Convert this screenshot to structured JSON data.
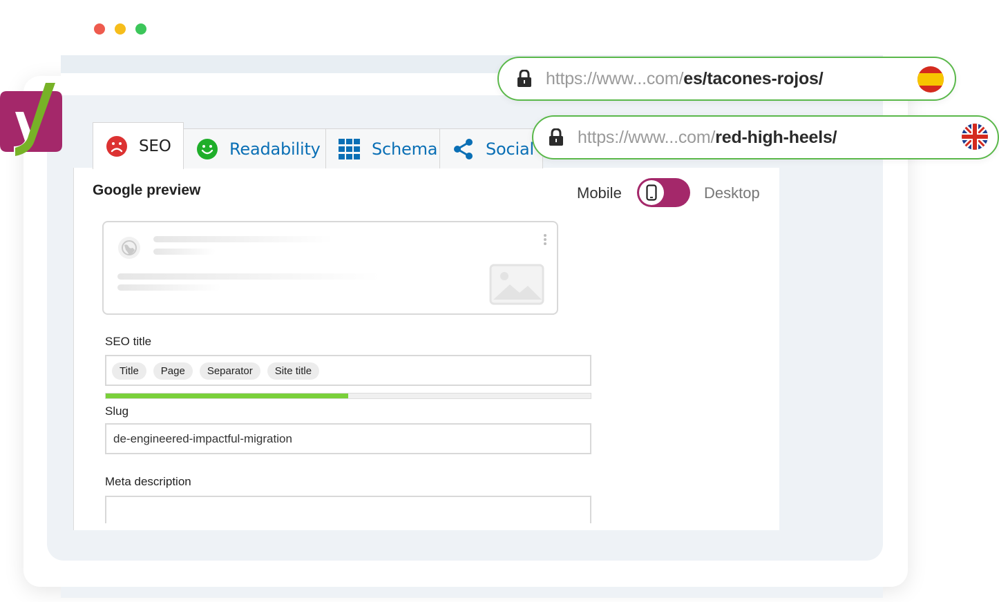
{
  "window": {
    "controls": [
      {
        "name": "close",
        "color": "#ee5b4e"
      },
      {
        "name": "minimize",
        "color": "#f6bd1b"
      },
      {
        "name": "maximize",
        "color": "#3cc65a"
      }
    ]
  },
  "brand": {
    "logo_icon": "yoast-logo-icon",
    "accent": "#a4286a",
    "success": "#7ad03a",
    "url_border": "#5ab84a"
  },
  "tabs": [
    {
      "label": "SEO",
      "icon": "sad-face-icon",
      "active": true
    },
    {
      "label": "Readability",
      "icon": "smiley-face-icon",
      "active": false
    },
    {
      "label": "Schema",
      "icon": "grid-icon",
      "active": false
    },
    {
      "label": "Social",
      "icon": "share-icon",
      "active": false
    }
  ],
  "google_preview": {
    "title": "Google preview",
    "mobile_label": "Mobile",
    "desktop_label": "Desktop",
    "mode": "Mobile"
  },
  "seo_title": {
    "label": "SEO title",
    "variables": [
      "Title",
      "Page",
      "Separator",
      "Site title"
    ],
    "progress": 0.5
  },
  "slug": {
    "label": "Slug",
    "value": "de-engineered-impactful-migration"
  },
  "meta_description": {
    "label": "Meta description",
    "value": ""
  },
  "urls": [
    {
      "prefix": "https://www...com/",
      "path": "es/tacones-rojos/",
      "flag": "spain-flag-icon"
    },
    {
      "prefix": "https://www...com/",
      "path": "red-high-heels/",
      "flag": "uk-flag-icon"
    }
  ]
}
